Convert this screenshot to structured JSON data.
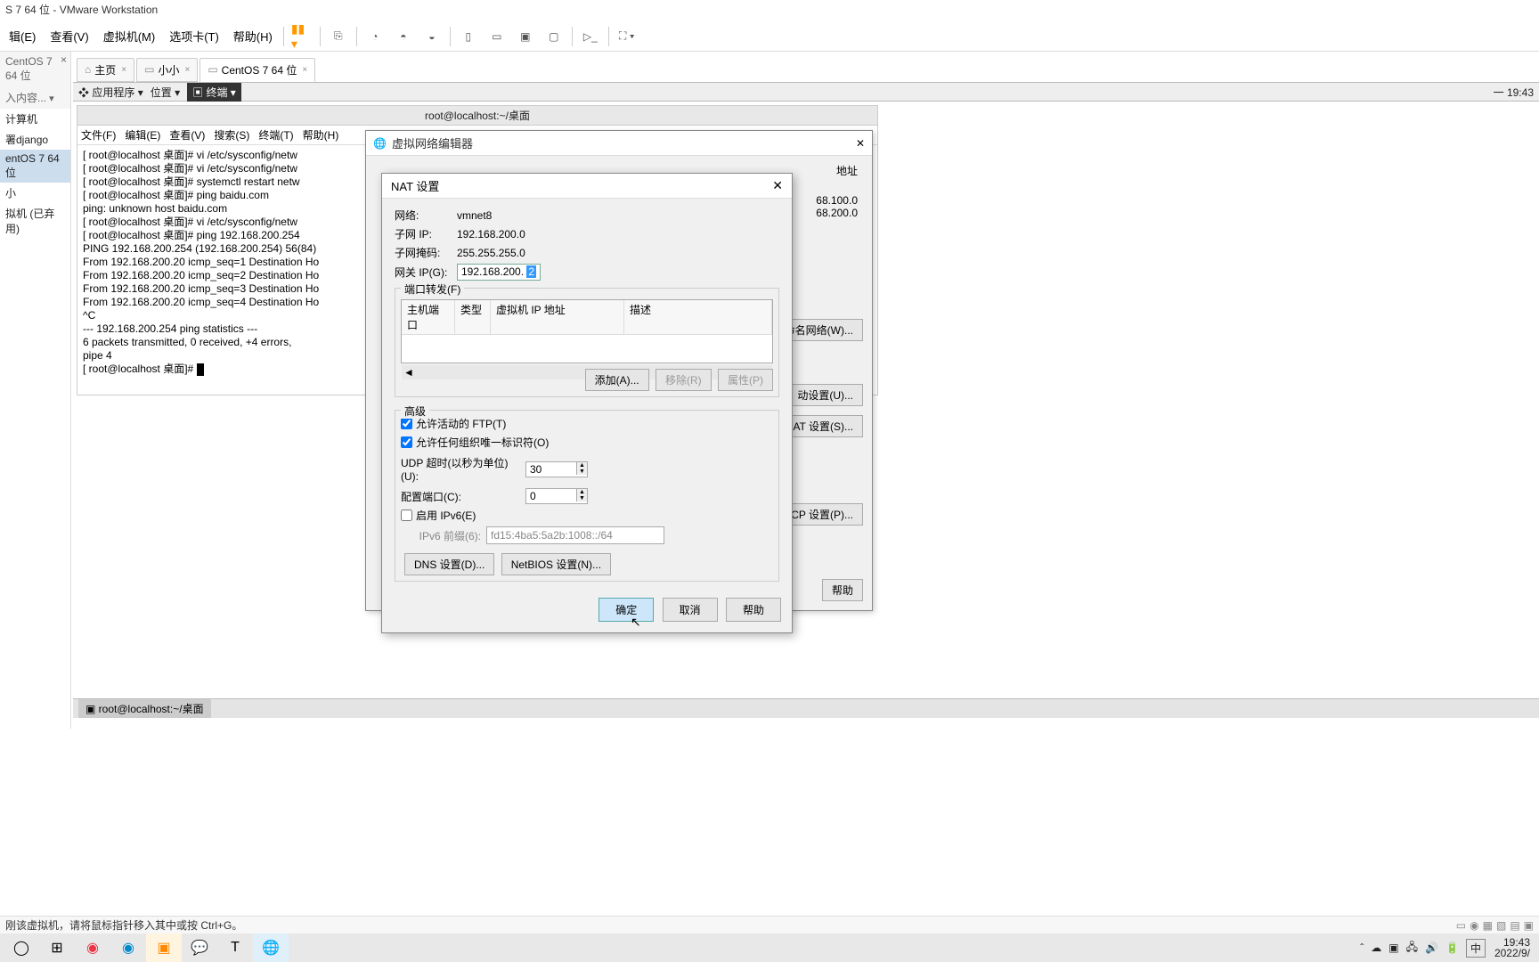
{
  "window": {
    "title": "S 7 64 位 - VMware Workstation"
  },
  "menu": {
    "file": "辑(E)",
    "view": "查看(V)",
    "vm": "虚拟机(M)",
    "tabs": "选项卡(T)",
    "help": "帮助(H)"
  },
  "sidebar": {
    "heading": "入内容...",
    "items": [
      "计算机",
      "署django",
      "entOS 7 64 位",
      "小",
      "拟机 (已弃用)"
    ]
  },
  "tabs": {
    "home": "主页",
    "t1": "小小",
    "t2": "CentOS 7 64 位"
  },
  "gnome": {
    "apps": "应用程序",
    "places": "位置",
    "term": "终端",
    "clock": "一 19:43"
  },
  "terminal": {
    "title": "root@localhost:~/桌面",
    "menus": [
      "文件(F)",
      "编辑(E)",
      "查看(V)",
      "搜索(S)",
      "终端(T)",
      "帮助(H)"
    ],
    "content": "[ root@localhost 桌面]# vi /etc/sysconfig/netw\n[ root@localhost 桌面]# vi /etc/sysconfig/netw\n[ root@localhost 桌面]# systemctl restart netw\n[ root@localhost 桌面]# ping baidu.com\nping: unknown host baidu.com\n[ root@localhost 桌面]# vi /etc/sysconfig/netw\n[ root@localhost 桌面]# ping 192.168.200.254\nPING 192.168.200.254 (192.168.200.254) 56(84)\nFrom 192.168.200.20 icmp_seq=1 Destination Ho\nFrom 192.168.200.20 icmp_seq=2 Destination Ho\nFrom 192.168.200.20 icmp_seq=3 Destination Ho\nFrom 192.168.200.20 icmp_seq=4 Destination Ho\n^C\n--- 192.168.200.254 ping statistics ---\n6 packets transmitted, 0 received, +4 errors,\npipe 4\n[ root@localhost 桌面]# "
  },
  "vne": {
    "title": "虚拟网络编辑器",
    "addr_hdr": "地址",
    "addr1": "68.100.0",
    "addr2": "68.200.0",
    "btn_rename": "命名网络(W)...",
    "btn_auto": "动设置(U)...",
    "btn_nat": "AT 设置(S)...",
    "btn_dhcp": "CP 设置(P)...",
    "btn_help": "帮助"
  },
  "nat": {
    "title": "NAT 设置",
    "net_lbl": "网络:",
    "net_val": "vmnet8",
    "subnet_lbl": "子网 IP:",
    "subnet_val": "192.168.200.0",
    "mask_lbl": "子网掩码:",
    "mask_val": "255.255.255.0",
    "gw_lbl": "网关 IP(G):",
    "gw_prefix": "192.168.200. ",
    "gw_sel": "2",
    "pf_title": "端口转发(F)",
    "pf_cols": [
      "主机端口",
      "类型",
      "虚拟机 IP 地址",
      "描述"
    ],
    "btn_add": "添加(A)...",
    "btn_remove": "移除(R)",
    "btn_prop": "属性(P)",
    "adv_title": "高级",
    "chk_ftp": "允许活动的 FTP(T)",
    "chk_org": "允许任何组织唯一标识符(O)",
    "udp_lbl": "UDP 超时(以秒为单位)(U):",
    "udp_val": "30",
    "cfg_lbl": "配置端口(C):",
    "cfg_val": "0",
    "ipv6_chk": "启用 IPv6(E)",
    "ipv6_lbl": "IPv6 前缀(6):",
    "ipv6_val": "fd15:4ba5:5a2b:1008::/64",
    "btn_dns": "DNS 设置(D)...",
    "btn_netbios": "NetBIOS 设置(N)...",
    "ok": "确定",
    "cancel": "取消",
    "help": "帮助"
  },
  "gnometask": {
    "running": "root@localhost:~/桌面"
  },
  "status": {
    "text": "刚该虚拟机，请将鼠标指针移入其中或按 Ctrl+G。"
  },
  "wintask": {
    "ime": "中",
    "time": "19:43",
    "date": "2022/9/"
  }
}
